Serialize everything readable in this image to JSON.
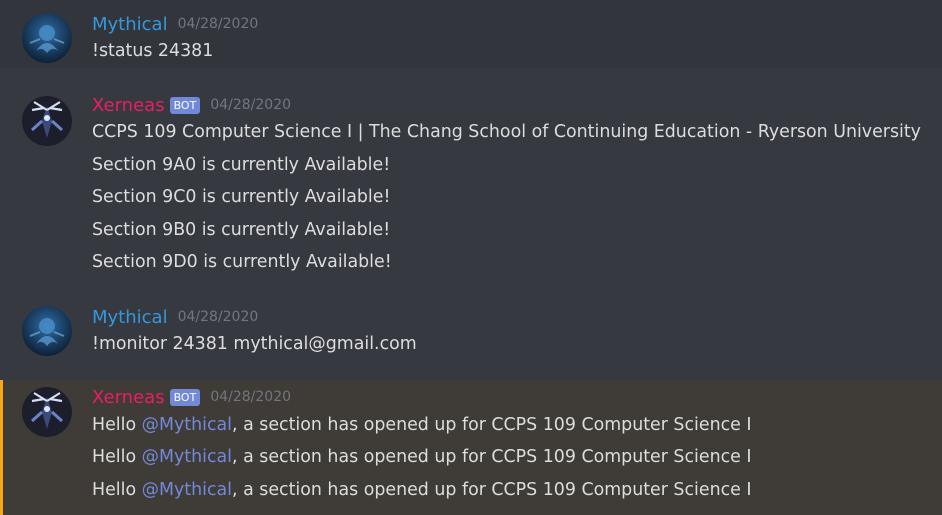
{
  "colors": {
    "background": "#36393f",
    "user_name": "#3498db",
    "bot_name": "#e91e63",
    "bot_tag": "#7289da",
    "timestamp": "#72767d",
    "text": "#dcddde",
    "mention_bar": "#faa61a",
    "mention_link": "#7289da"
  },
  "messages": [
    {
      "author": "Mythical",
      "avatar_icon": "user-avatar-icon",
      "timestamp": "04/28/2020",
      "lines": [
        "!status 24381"
      ]
    },
    {
      "author": "Xerneas",
      "bot_tag": "BOT",
      "avatar_icon": "xerneas-avatar-icon",
      "timestamp": "04/28/2020",
      "lines": [
        "CCPS 109 Computer Science I | The Chang School of Continuing Education - Ryerson University",
        "Section 9A0 is currently Available!",
        "Section 9C0 is currently Available!",
        "Section 9B0 is currently Available!",
        "Section 9D0 is currently Available!"
      ]
    },
    {
      "author": "Mythical",
      "avatar_icon": "user-avatar-icon",
      "timestamp": "04/28/2020",
      "lines": [
        "!monitor 24381 mythical@gmail.com"
      ]
    },
    {
      "author": "Xerneas",
      "bot_tag": "BOT",
      "avatar_icon": "xerneas-avatar-icon",
      "timestamp": "04/28/2020",
      "lines": [
        {
          "prefix": "Hello ",
          "mention": "@Mythical",
          "suffix": ", a section has opened up for CCPS 109 Computer Science I"
        },
        {
          "prefix": "Hello ",
          "mention": "@Mythical",
          "suffix": ", a section has opened up for CCPS 109 Computer Science I"
        },
        {
          "prefix": "Hello ",
          "mention": "@Mythical",
          "suffix": ", a section has opened up for CCPS 109 Computer Science I"
        }
      ]
    }
  ]
}
